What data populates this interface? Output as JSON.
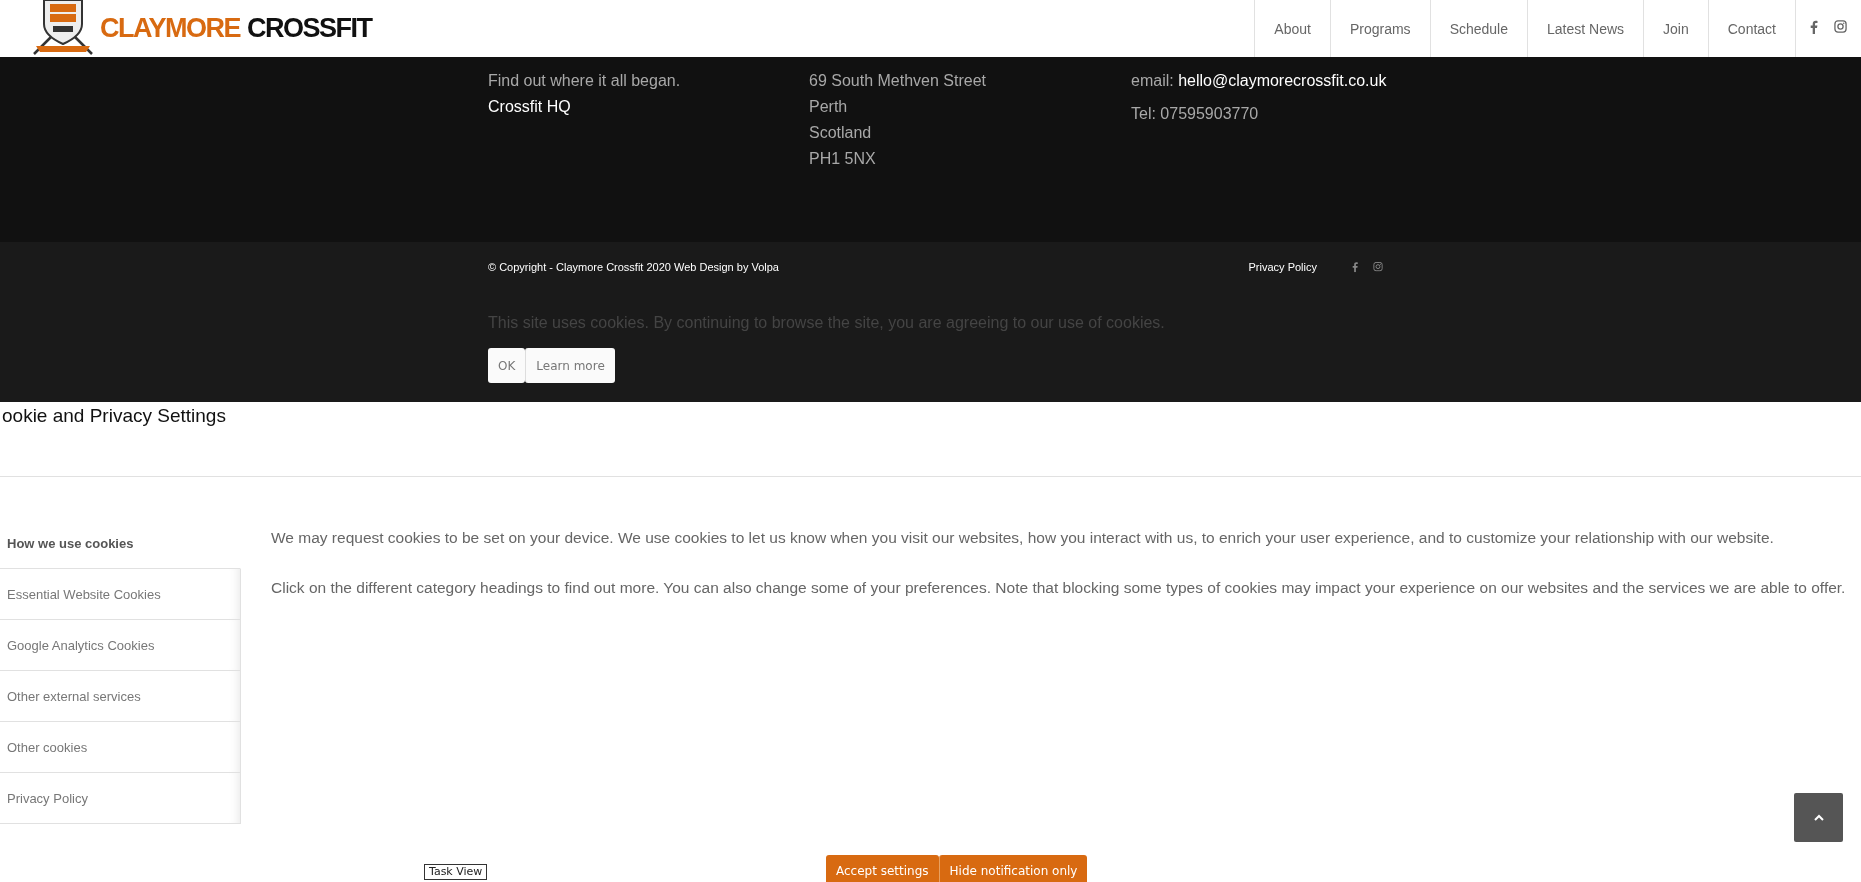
{
  "header": {
    "logo": {
      "word_1": "CLAYMORE",
      "word_2": "CROSSFIT"
    },
    "nav": [
      {
        "label": "About"
      },
      {
        "label": "Programs"
      },
      {
        "label": "Schedule"
      },
      {
        "label": "Latest News"
      },
      {
        "label": "Join"
      },
      {
        "label": "Contact"
      }
    ]
  },
  "footer": {
    "about": {
      "text": "Find out where it all began.",
      "link": "Crossfit HQ"
    },
    "address": [
      "69 South Methven Street",
      "Perth",
      "Scotland",
      "PH1 5NX"
    ],
    "contact": {
      "email_label": "email:",
      "email": "hello@claymorecrossfit.co.uk",
      "phone": "Tel: 07595903770"
    }
  },
  "socket": {
    "copyright": "© Copyright - Claymore Crossfit 2020 Web Design by Volpa",
    "privacy_link": "Privacy Policy"
  },
  "cookie_bar": {
    "message": "This site uses cookies. By continuing to browse the site, you are agreeing to our use of cookies.",
    "buttons": [
      "OK",
      "Learn more"
    ]
  },
  "modal": {
    "title": "ookie and Privacy Settings",
    "tabs": [
      {
        "label": "How we use cookies",
        "selected": true
      },
      {
        "label": "Essential Website Cookies",
        "selected": false
      },
      {
        "label": "Google Analytics Cookies",
        "selected": false
      },
      {
        "label": "Other external services",
        "selected": false
      },
      {
        "label": "Other cookies",
        "selected": false
      },
      {
        "label": "Privacy Policy",
        "selected": false
      }
    ],
    "paragraphs": [
      "We may request cookies to be set on your device. We use cookies to let us know when you visit our websites, how you interact with us, to enrich your user experience, and to customize your relationship with our website.",
      "Click on the different category headings to find out more. You can also change some of your preferences. Note that blocking some types of cookies may impact your experience on our websites and the services we are able to offer."
    ],
    "buttons": [
      "Accept settings",
      "Hide notification only"
    ]
  },
  "tooltip": "Task View"
}
